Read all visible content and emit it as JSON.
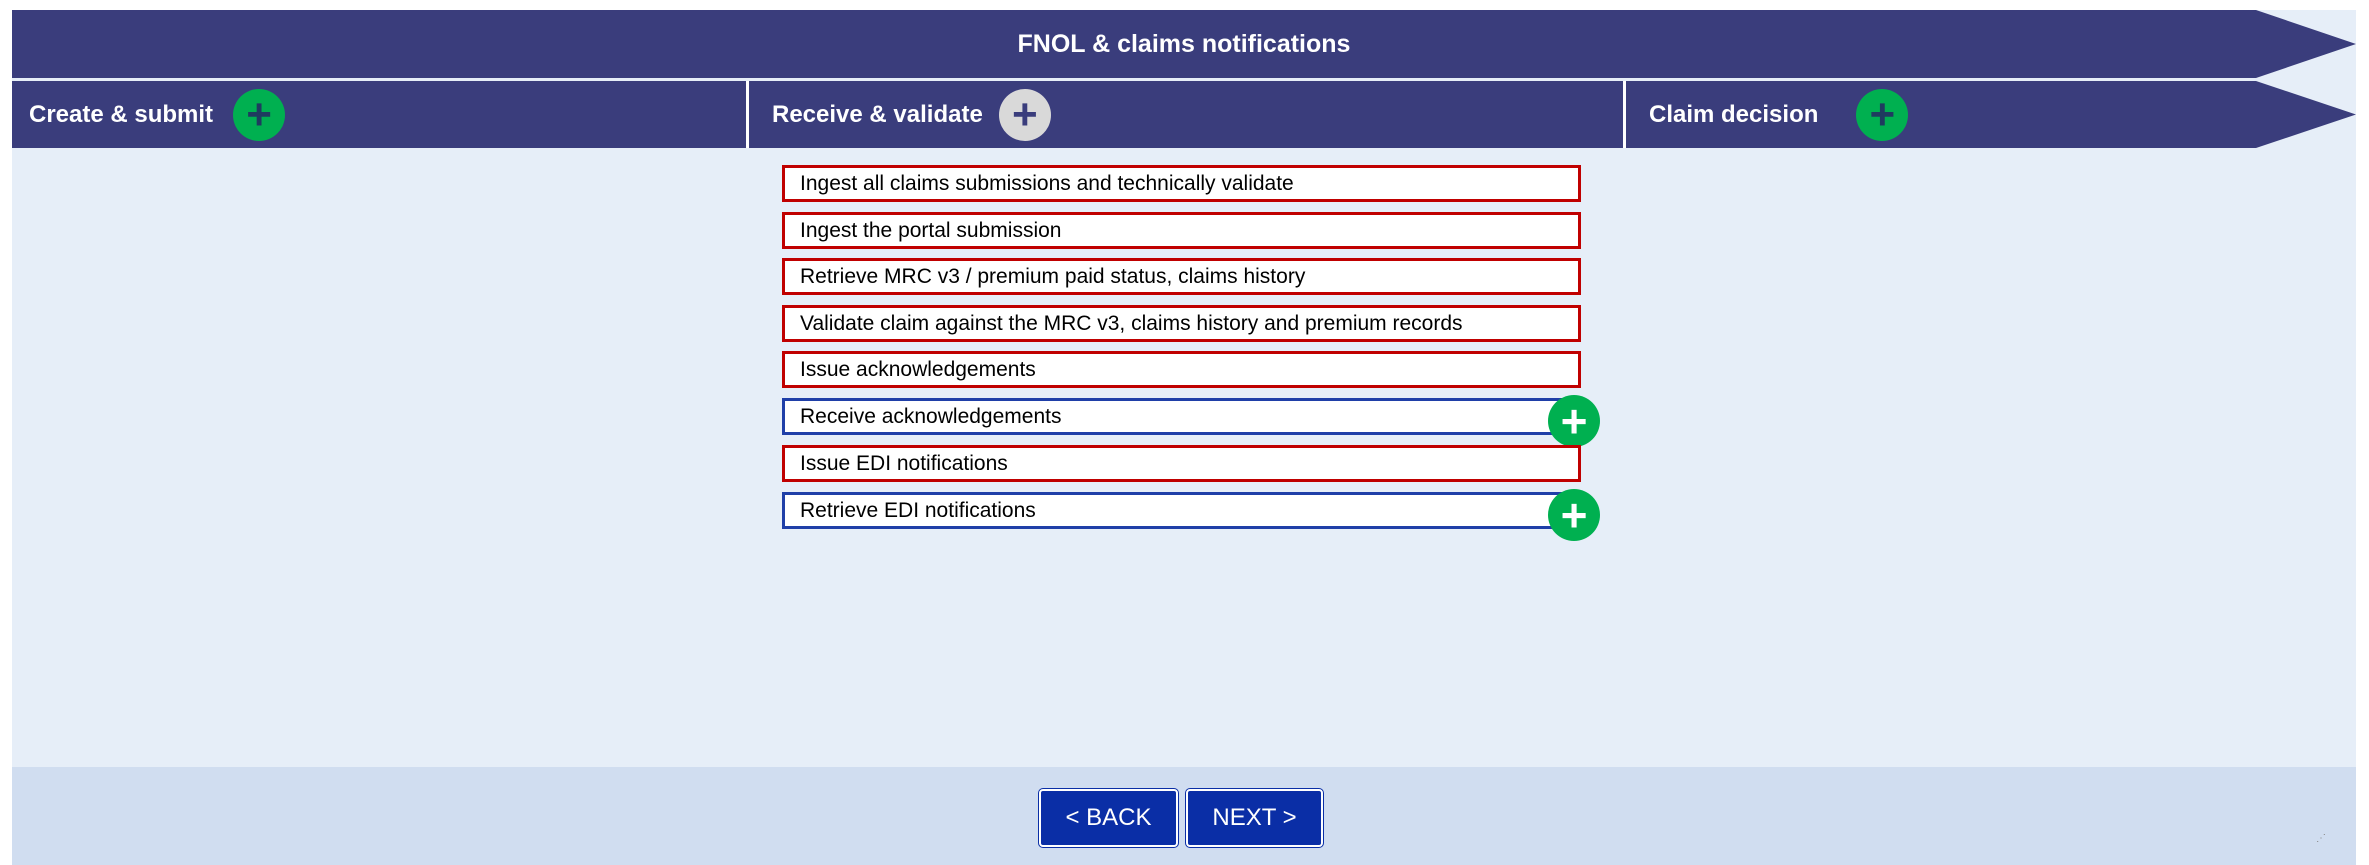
{
  "banner": {
    "title": "FNOL & claims notifications"
  },
  "phases": [
    {
      "label": "Create & submit",
      "icon": "plus-icon",
      "icon_color": "#00b050"
    },
    {
      "label": "Receive & validate",
      "icon": "plus-icon",
      "icon_color": "#d9d9d9"
    },
    {
      "label": "Claim decision",
      "icon": "plus-icon",
      "icon_color": "#00b050"
    }
  ],
  "tasks": [
    {
      "label": "Ingest all claims submissions and technically validate",
      "border": "#c00000"
    },
    {
      "label": "Ingest the portal submission",
      "border": "#c00000"
    },
    {
      "label": "Retrieve MRC v3 / premium paid status, claims history",
      "border": "#c00000"
    },
    {
      "label": "Validate claim against the MRC v3, claims history and premium records",
      "border": "#c00000"
    },
    {
      "label": "Issue acknowledgements",
      "border": "#c00000"
    },
    {
      "label": "Receive acknowledgements",
      "border": "#1f3fa8",
      "icon": "plus-icon"
    },
    {
      "label": "Issue EDI notifications",
      "border": "#c00000"
    },
    {
      "label": "Retrieve EDI notifications",
      "border": "#1f3fa8",
      "icon": "plus-icon"
    }
  ],
  "nav": {
    "back_label": "< BACK",
    "next_label": "NEXT >"
  },
  "colors": {
    "banner": "#3a3d7c",
    "background": "#e6eef8",
    "footer": "#d0ddf0",
    "nav_button": "#0a2ea6",
    "add": "#00b050"
  }
}
